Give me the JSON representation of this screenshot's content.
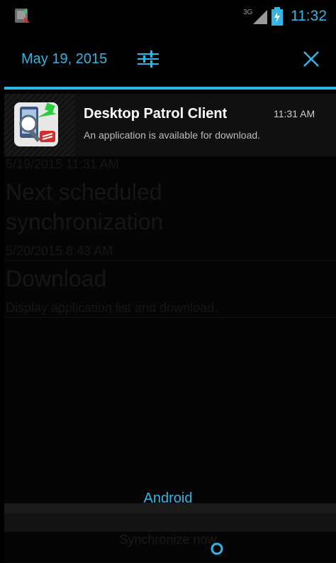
{
  "status_bar": {
    "signal_label": "3G",
    "time": "11:32",
    "icons": [
      "app-notification-icon",
      "signal-icon",
      "battery-icon"
    ]
  },
  "header": {
    "date": "May 19, 2015",
    "icons": [
      "settings-sliders-icon",
      "close-icon"
    ]
  },
  "notification": {
    "title": "Desktop Patrol Client",
    "time": "11:31 AM",
    "body": "An application is available for download.",
    "icon": "desktop-patrol-app-icon"
  },
  "background_app": {
    "last_sync_time": "5/19/2015 11:31 AM",
    "next_sync_title": "Next scheduled synchronization",
    "next_sync_title_line1": "Next scheduled",
    "next_sync_title_line2": "synchronization",
    "next_sync_time": "5/20/2015 8:43 AM",
    "download_title": "Download",
    "download_desc": "Display application list and download.",
    "sync_button": "Synchronize now"
  },
  "footer": {
    "carrier": "Android"
  },
  "colors": {
    "accent": "#33b5e5",
    "background": "#000000"
  }
}
